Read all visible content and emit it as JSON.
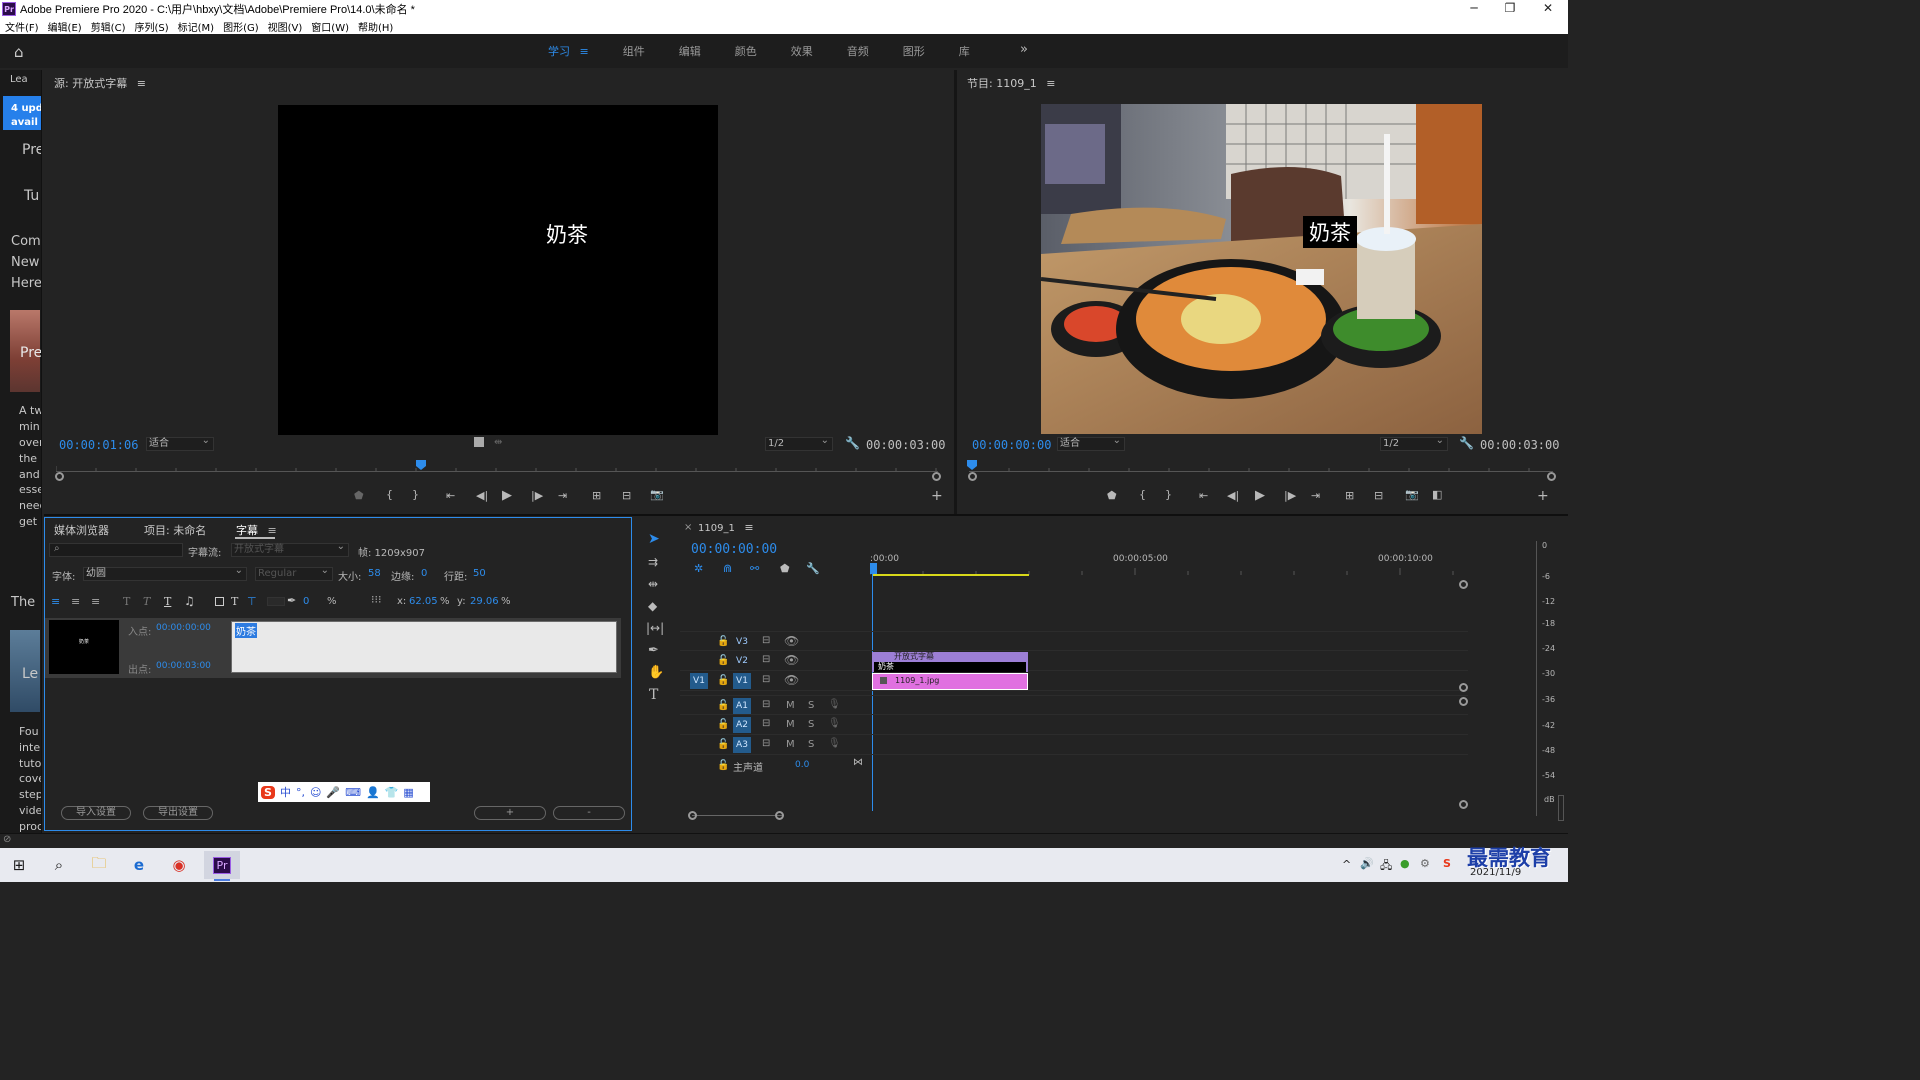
{
  "window": {
    "title": "Adobe Premiere Pro 2020 - C:\\用户\\hbxy\\文档\\Adobe\\Premiere Pro\\14.0\\未命名 *",
    "logo": "Pr",
    "minimize": "─",
    "maximize": "❐",
    "close": "✕"
  },
  "menu": [
    "文件(F)",
    "编辑(E)",
    "剪辑(C)",
    "序列(S)",
    "标记(M)",
    "图形(G)",
    "视图(V)",
    "窗口(W)",
    "帮助(H)"
  ],
  "workspaces": {
    "tabs": [
      "学习",
      "组件",
      "编辑",
      "颜色",
      "效果",
      "音频",
      "图形",
      "库"
    ],
    "active": "学习",
    "menu_glyph": "≡",
    "more": "»"
  },
  "learn_panel": {
    "tab": "Lea",
    "update_badge_line1": "4 upd",
    "update_badge_line2": "avail",
    "lines": [
      "Pre",
      "Tu",
      "Com",
      "New",
      "Here",
      "Pre",
      "A tw",
      "min",
      "over",
      "the",
      "and",
      "esse",
      "need",
      "get",
      "The",
      "Le",
      "Fou",
      "inte",
      "tuto",
      "cove",
      "step",
      "vide",
      "proc"
    ]
  },
  "source_monitor": {
    "title": "源: 开放式字幕",
    "menu_glyph": "≡",
    "caption_text": "奶茶",
    "timecode": "00:00:01:06",
    "fit": "适合",
    "resolution": "1/2",
    "duration": "00:00:03:00"
  },
  "program_monitor": {
    "title": "节目: 1109_1",
    "menu_glyph": "≡",
    "caption_text": "奶茶",
    "timecode": "00:00:00:00",
    "fit": "适合",
    "resolution": "1/2",
    "duration": "00:00:03:00"
  },
  "captions_panel": {
    "tabs": [
      "媒体浏览器",
      "项目: 未命名",
      "字幕"
    ],
    "active_tab": "字幕",
    "menu_glyph": "≡",
    "stream_label": "字幕流:",
    "stream_value": "开放式字幕",
    "frame_label": "帧: 1209x907",
    "font_label": "字体:",
    "font_value": "幼圆",
    "style_value": "Regular",
    "size_label": "大小:",
    "size_value": "58",
    "edge_label": "边缘:",
    "edge_value": "0",
    "spacing_label": "行距:",
    "spacing_value": "50",
    "opacity_value": "0",
    "percent": "%",
    "x_label": "x:",
    "x_value": "62.05",
    "y_label": "y:",
    "y_value": "29.06",
    "in_label": "入点:",
    "in_value": "00:00:00:00",
    "out_label": "出点:",
    "out_value": "00:00:03:00",
    "caption_text": "奶茶",
    "thumb_text": "奶茶",
    "import_button": "导入设置",
    "export_button": "导出设置",
    "add_button": "+",
    "remove_button": "-"
  },
  "ime_toolbar": {
    "logo": "S",
    "items": [
      "中",
      "°,",
      "☺",
      "🎤",
      "⌨",
      "👤",
      "👕",
      "▦"
    ]
  },
  "timeline": {
    "close_glyph": "×",
    "sequence": "1109_1",
    "menu_glyph": "≡",
    "timecode": "00:00:00:00",
    "ruler_labels": [
      ":00:00",
      "00:00:05:00",
      "00:00:10:00"
    ],
    "video_tracks": [
      "V3",
      "V2",
      "V1"
    ],
    "source_patch": "V1",
    "audio_tracks": [
      "A1",
      "A2",
      "A3"
    ],
    "mute": "M",
    "solo": "S",
    "master_label": "主声道",
    "master_value": "0.0",
    "clips": {
      "caption_clip": "开放式字幕",
      "caption_text": "奶茶",
      "image_clip": "1109_1.jpg"
    }
  },
  "meter": {
    "labels": [
      "0",
      "-6",
      "-12",
      "-18",
      "-24",
      "-30",
      "-36",
      "-42",
      "-48",
      "-54",
      "dB"
    ]
  },
  "taskbar": {
    "date": "2021/11/9",
    "watermark": "最需教育",
    "pr_icon": "Pr"
  },
  "colors": {
    "accent_blue": "#2d8ceb",
    "caption_clip": "#9d7fd6",
    "image_clip": "#e070e0",
    "playhead": "#2d8ceb",
    "work_area": "#d8d81a"
  }
}
